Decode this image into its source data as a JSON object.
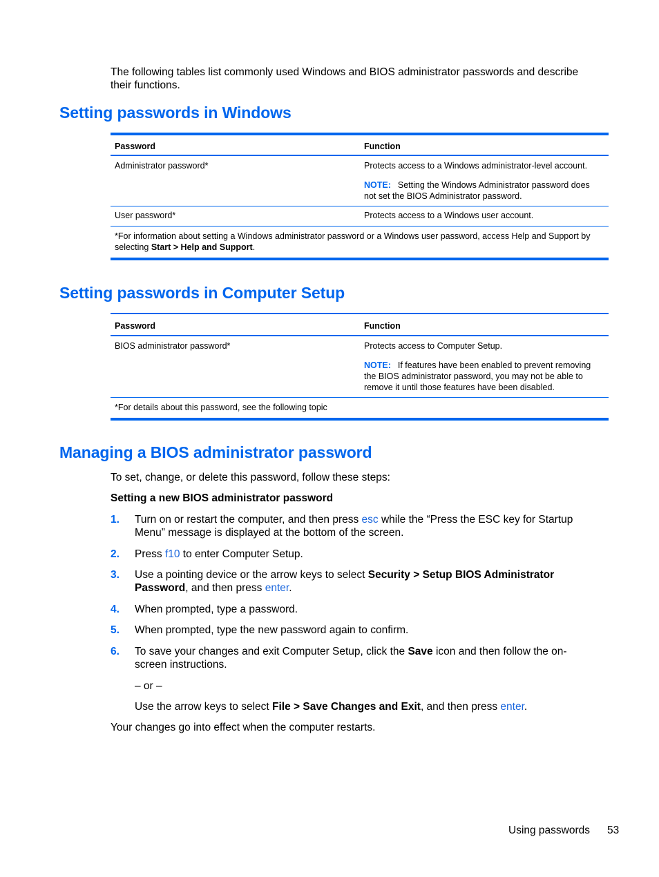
{
  "intro": "The following tables list commonly used Windows and BIOS administrator passwords and describe their functions.",
  "intro_lines": [
    "The following tables list commonly used Windows and BIOS administrator passwords and describe",
    "their functions."
  ],
  "sections": [
    {
      "title": "Setting passwords in Windows",
      "table": {
        "headers": [
          "Password",
          "Function"
        ],
        "rows": [
          {
            "password": "Administrator password*",
            "function": "Protects access to a Windows administrator-level account.",
            "note_label": "NOTE:",
            "note_lines": [
              "Setting the Windows Administrator password does",
              "not set the BIOS Administrator password."
            ]
          },
          {
            "password": "User password*",
            "function": "Protects access to a Windows user account."
          }
        ],
        "footnote_line1": "*For information about setting a Windows administrator password or a Windows user password, access Help and Support by",
        "footnote_line2_prefix": "selecting ",
        "footnote_line2_bold": "Start > Help and Support",
        "footnote_line2_suffix": "."
      }
    },
    {
      "title": "Setting passwords in Computer Setup",
      "table": {
        "headers": [
          "Password",
          "Function"
        ],
        "rows": [
          {
            "password": "BIOS administrator password*",
            "function": "Protects access to Computer Setup.",
            "note_label": "NOTE:",
            "note_lines": [
              "If features have been enabled to prevent removing",
              "the BIOS administrator password, you may not be able to",
              "remove it until those features have been disabled."
            ]
          }
        ],
        "footnote": "*For details about this password, see the following topic"
      }
    },
    {
      "title": "Managing a BIOS administrator password",
      "intro": "To set, change, or delete this password, follow these steps:",
      "subheading": "Setting a new BIOS administrator password",
      "steps": [
        {
          "num": "1.",
          "parts": [
            "Turn on or restart the computer, and then press ",
            "esc",
            " while the “Press the ESC key for Startup",
            "Menu” message is displayed at the bottom of the screen."
          ]
        },
        {
          "num": "2.",
          "parts": [
            "Press ",
            "f10",
            " to enter Computer Setup."
          ]
        },
        {
          "num": "3.",
          "parts": [
            "Use a pointing device or the arrow keys to select ",
            "Security > Setup BIOS Administrator",
            "Password",
            ", and then press ",
            "enter",
            "."
          ]
        },
        {
          "num": "4.",
          "parts": [
            "When prompted, type a password."
          ]
        },
        {
          "num": "5.",
          "parts": [
            "When prompted, type the new password again to confirm."
          ]
        },
        {
          "num": "6.",
          "parts": [
            "To save your changes and exit Computer Setup, click the ",
            "Save",
            " icon and then follow the on-",
            "screen instructions."
          ]
        }
      ],
      "or_text": "– or –",
      "alt_parts": [
        "Use the arrow keys to select ",
        "File > Save Changes and Exit",
        ", and then press ",
        "enter",
        "."
      ],
      "closing": "Your changes go into effect when the computer restarts."
    }
  ],
  "footer": {
    "chapter": "Using passwords",
    "page_number": "53"
  },
  "colors": {
    "accent": "#0066ee",
    "key_link": "#1a66dd"
  }
}
